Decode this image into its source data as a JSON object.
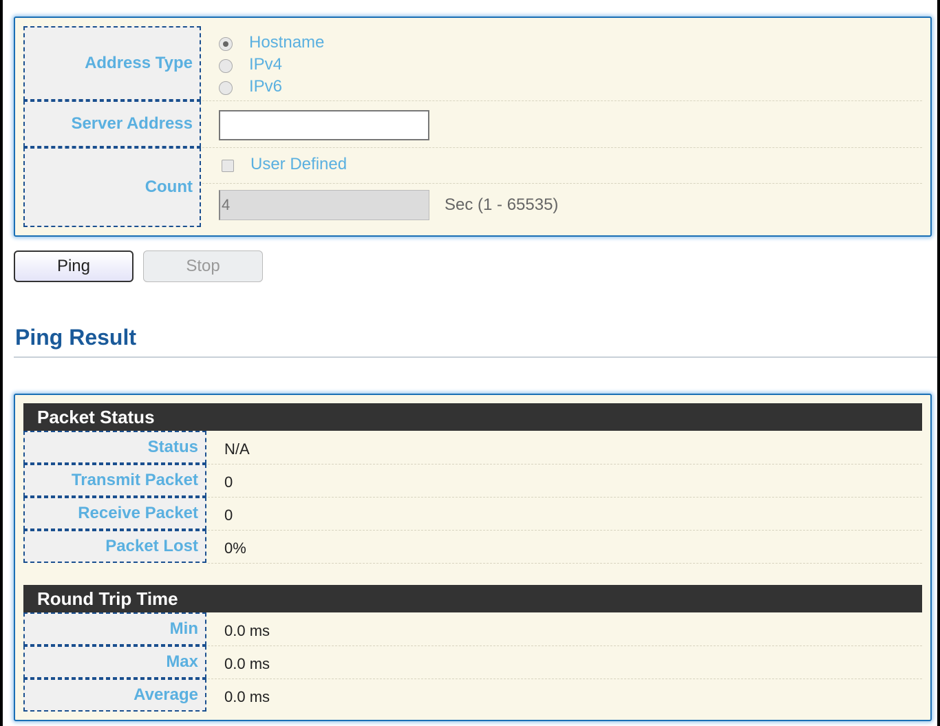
{
  "settings": {
    "address_type": {
      "label": "Address Type",
      "options": [
        "Hostname",
        "IPv4",
        "IPv6"
      ],
      "selected": "Hostname"
    },
    "server_address": {
      "label": "Server Address",
      "value": ""
    },
    "count": {
      "label": "Count",
      "user_defined_label": "User Defined",
      "user_defined_checked": false,
      "value": "4",
      "unit": "Sec (1 - 65535)"
    }
  },
  "buttons": {
    "ping": "Ping",
    "stop": "Stop"
  },
  "result": {
    "title": "Ping Result",
    "packet_status": {
      "header": "Packet Status",
      "rows": [
        {
          "label": "Status",
          "value": "N/A"
        },
        {
          "label": "Transmit Packet",
          "value": "0"
        },
        {
          "label": "Receive Packet",
          "value": "0"
        },
        {
          "label": "Packet Lost",
          "value": "0%"
        }
      ]
    },
    "round_trip": {
      "header": "Round Trip Time",
      "rows": [
        {
          "label": "Min",
          "value": "0.0 ms"
        },
        {
          "label": "Max",
          "value": "0.0 ms"
        },
        {
          "label": "Average",
          "value": "0.0 ms"
        }
      ]
    }
  }
}
